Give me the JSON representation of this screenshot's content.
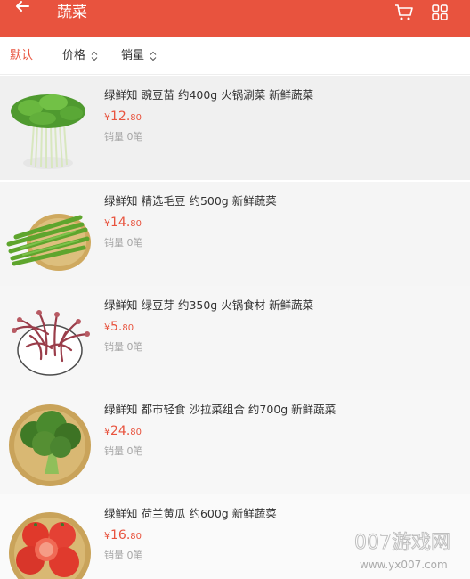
{
  "header": {
    "title": "蔬菜",
    "back_icon": "back-arrow-icon",
    "cart_icon": "cart-icon",
    "grid_icon": "grid-view-icon",
    "color": "#e8533e"
  },
  "sort": {
    "default_label": "默认",
    "price_label": "价格",
    "sales_label": "销量",
    "sort_icon": "sort-updown-icon",
    "active": "默认"
  },
  "products": [
    {
      "title": "绿鲜知 豌豆苗 约400g  火锅涮菜 新鲜蔬菜",
      "currency": "¥",
      "price_int": "12.",
      "price_dec": "80",
      "sales": "销量 0笔",
      "image": "pea-sprouts"
    },
    {
      "title": "绿鲜知 精选毛豆 约500g 新鲜蔬菜",
      "currency": "¥",
      "price_int": "14.",
      "price_dec": "80",
      "sales": "销量 0笔",
      "image": "edamame-pods"
    },
    {
      "title": "绿鲜知 绿豆芽 约350g 火锅食材 新鲜蔬菜",
      "currency": "¥",
      "price_int": "5.",
      "price_dec": "80",
      "sales": "销量 0笔",
      "image": "bean-sprouts"
    },
    {
      "title": "绿鲜知 都市轻食 沙拉菜组合 约700g 新鲜蔬菜",
      "currency": "¥",
      "price_int": "24.",
      "price_dec": "80",
      "sales": "销量 0笔",
      "image": "broccoli"
    },
    {
      "title": "绿鲜知 荷兰黄瓜 约600g 新鲜蔬菜",
      "currency": "¥",
      "price_int": "16.",
      "price_dec": "80",
      "sales": "销量 0笔",
      "image": "tomatoes"
    }
  ],
  "watermark": {
    "main": "007游戏网",
    "url": "www.yx007.com"
  },
  "colors": {
    "accent": "#e8533e",
    "text": "#333333",
    "muted": "#a6a6a6"
  }
}
